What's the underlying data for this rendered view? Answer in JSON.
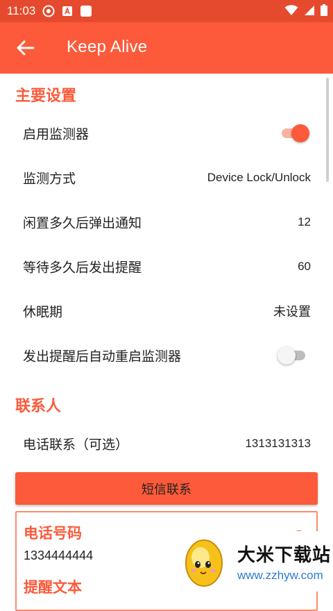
{
  "status_bar": {
    "time": "11:03"
  },
  "app_bar": {
    "title": "Keep Alive"
  },
  "sections": {
    "main": "主要设置",
    "contacts": "联系人"
  },
  "settings": {
    "enable_monitor": {
      "label": "启用监测器",
      "on": true
    },
    "monitor_mode": {
      "label": "监测方式",
      "value": "Device Lock/Unlock"
    },
    "idle_notify": {
      "label": "闲置多久后弹出通知",
      "value": "12"
    },
    "wait_alert": {
      "label": "等待多久后发出提醒",
      "value": "60"
    },
    "rest_period": {
      "label": "休眠期",
      "value": "未设置"
    },
    "auto_restart": {
      "label": "发出提醒后自动重启监测器",
      "on": false
    }
  },
  "contacts": {
    "phone_contact": {
      "label": "电话联系（可选）",
      "value": "1313131313"
    },
    "sms_button": "短信联系"
  },
  "sms_card": {
    "phone_title": "电话号码",
    "phone_number": "1334444444",
    "message_title": "提醒文本"
  },
  "watermark": {
    "brand": "大米下载站",
    "url": "www.zzhyw.com"
  },
  "colors": {
    "accent": "#fc5a3a",
    "status_bar": "#e64a2e"
  }
}
